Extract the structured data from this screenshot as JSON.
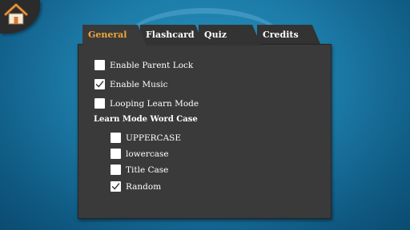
{
  "tabs": [
    {
      "label": "General",
      "active": true
    },
    {
      "label": "Flashcard",
      "active": false
    },
    {
      "label": "Quiz",
      "active": false
    },
    {
      "label": "Credits",
      "active": false
    }
  ],
  "options": [
    {
      "label": "Enable Parent Lock",
      "checked": false
    },
    {
      "label": "Enable Music",
      "checked": true
    },
    {
      "label": "Looping Learn Mode",
      "checked": false
    }
  ],
  "word_case": {
    "heading": "Learn Mode Word Case",
    "choices": [
      {
        "label": "UPPERCASE",
        "checked": false
      },
      {
        "label": "lowercase",
        "checked": false
      },
      {
        "label": "Title Case",
        "checked": false
      },
      {
        "label": "Random",
        "checked": true
      }
    ]
  },
  "colors": {
    "active_tab_text": "#f0a63c",
    "panel": "#3a3a3a",
    "background": "#1c7aa6"
  },
  "icons": {
    "home": "home-icon",
    "check": "checkmark-icon"
  }
}
